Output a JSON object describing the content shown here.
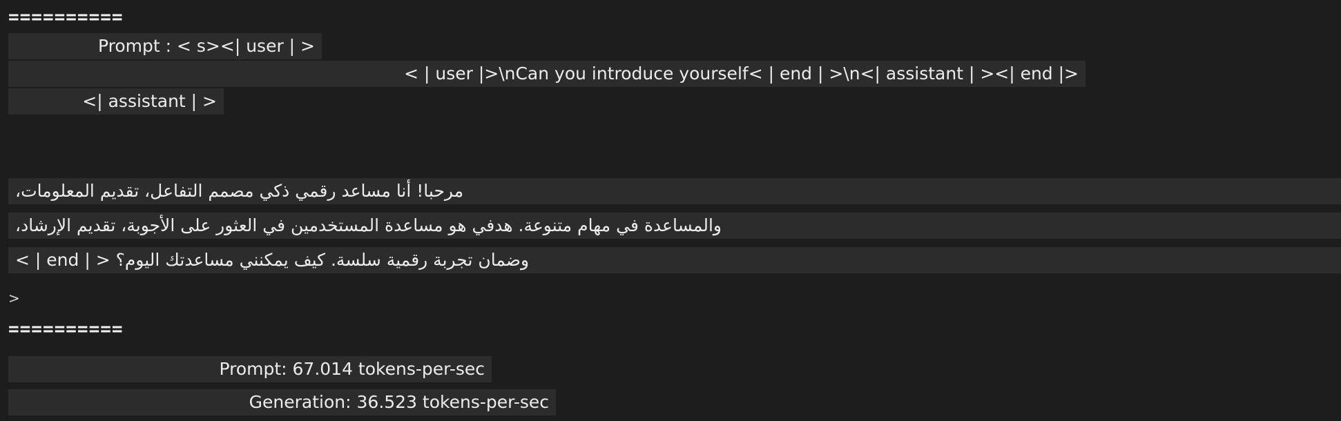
{
  "separator_top": "==========",
  "separator_bottom": "==========",
  "prompt_line_1": "Prompt : < s><| user | >",
  "prompt_line_2": "< | user |>\\nCan you introduce yourself< | end | >\\n<| assistant | ><| end |>",
  "prompt_line_3": "<| assistant | >",
  "response_line_1": "مرحبا! أنا مساعد رقمي ذكي مصمم التفاعل، تقديم المعلومات،",
  "response_line_2": "والمساعدة في مهام متنوعة. هدفي هو مساعدة المستخدمين في العثور على الأجوبة، تقديم الإرشاد،",
  "response_line_3": "وضمان تجربة رقمية سلسة. كيف يمكنني مساعدتك اليوم؟ < | end | >",
  "trailing_marker": ">",
  "stats": {
    "prompt_speed": "Prompt: 67.014 tokens-per-sec",
    "generation_speed": "Generation: 36.523 tokens-per-sec"
  }
}
